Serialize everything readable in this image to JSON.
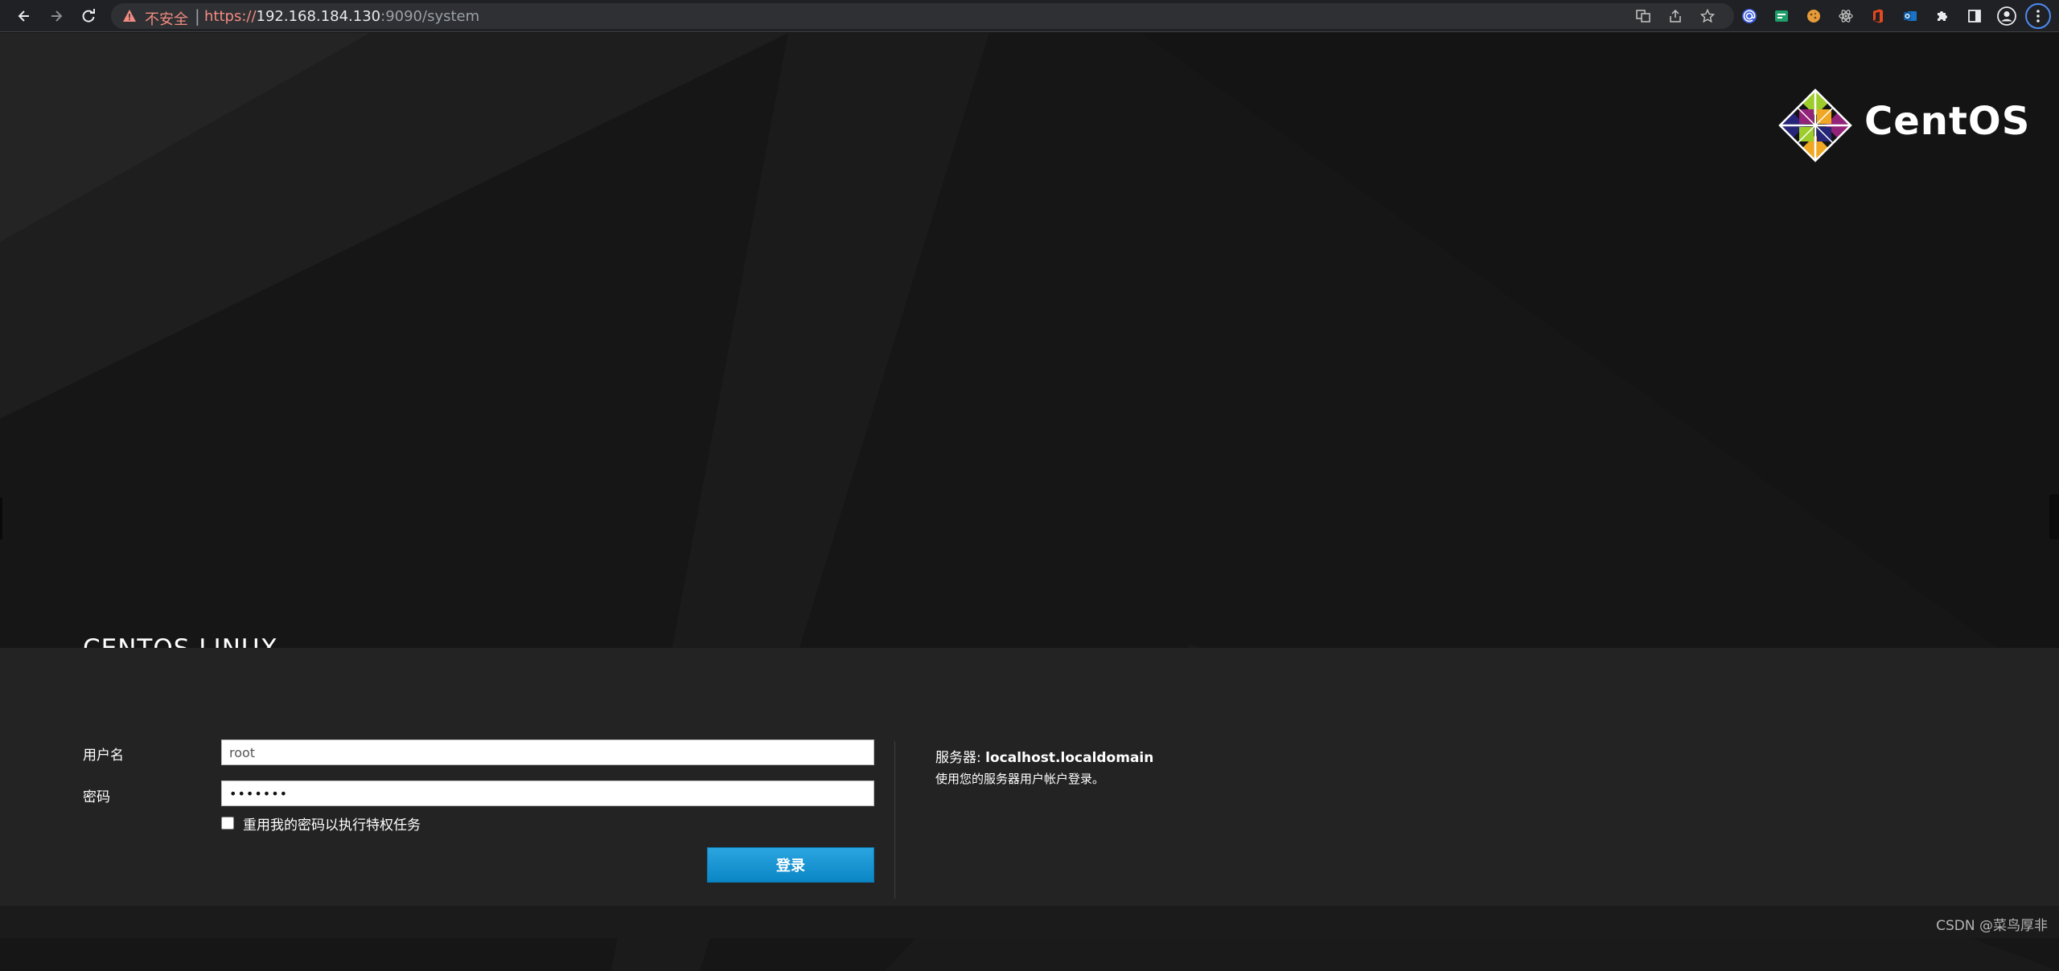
{
  "browser": {
    "back_icon": "arrow-left-icon",
    "forward_icon": "arrow-right-icon",
    "reload_icon": "reload-icon",
    "security_warning": "不安全",
    "url_scheme": "https://",
    "url_host": "192.168.184.130",
    "url_rest": ":9090/system",
    "omnibox_icons": [
      "translate-icon",
      "share-icon",
      "star-icon"
    ],
    "extensions": [
      "at-icon",
      "extension-green-icon",
      "cookie-icon",
      "react-icon",
      "office-icon",
      "outlook-icon",
      "puzzle-icon"
    ],
    "sidepanel_icon": "side-panel-icon",
    "profile_icon": "profile-icon",
    "menu_icon": "more-vert-icon"
  },
  "branding": {
    "logo_text": "CentOS",
    "product_name": "CENTOS LINUX"
  },
  "login": {
    "username_label": "用户名",
    "username_value": "root",
    "password_label": "密码",
    "password_value": "•••••••",
    "reuse_password_label": "重用我的密码以执行特权任务",
    "reuse_password_checked": false,
    "login_button": "登录"
  },
  "server_info": {
    "server_label": "服务器:",
    "server_name": "localhost.localdomain",
    "help_text": "使用您的服务器用户帐户登录。"
  },
  "footer": {
    "watermark": "CSDN @菜鸟厚非"
  },
  "colors": {
    "background": "#161616",
    "login_panel": "#232323",
    "button_blue": "#1a96d4",
    "insecure_red": "#f28b82"
  }
}
